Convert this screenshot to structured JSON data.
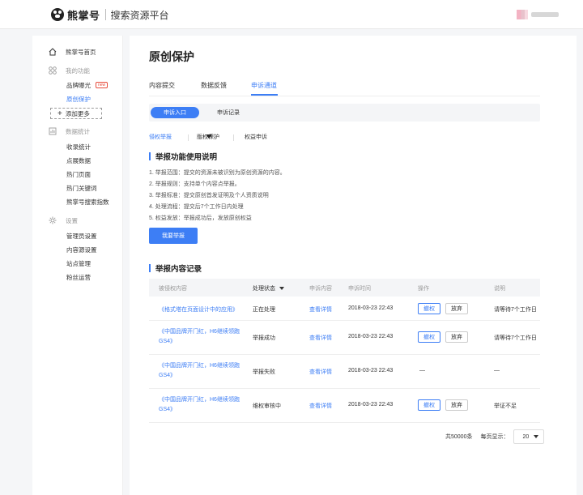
{
  "app": {
    "logo_text": "熊掌号",
    "subtitle": "搜索资源平台"
  },
  "sidebar": {
    "home": "熊掌号首页",
    "group_features": "我的功能",
    "features": [
      {
        "label": "品牌曝光",
        "badge": "new"
      },
      {
        "label": "原创保护"
      }
    ],
    "add_more": "添加更多",
    "group_stats": "数据统计",
    "stats": [
      "收录统计",
      "点展数据",
      "热门页面",
      "热门关键词",
      "熊掌号搜索指数"
    ],
    "group_settings": "设置",
    "settings": [
      "管理员设置",
      "内容源设置",
      "站点管理",
      "粉丝运营"
    ]
  },
  "page": {
    "title": "原创保护"
  },
  "tabs": [
    "内容提交",
    "数据反馈",
    "申诉通道"
  ],
  "segments": [
    "申诉入口",
    "申诉记录"
  ],
  "subtabs": [
    "侵权举报",
    "版权保护",
    "权益申诉"
  ],
  "instructions": {
    "title": "举报功能使用说明",
    "items": [
      "1. 举报范围：提交的资源未被识别为原创资源的内容。",
      "2. 举报规则：支持单个内容点举报。",
      "3. 举报标准：提交原创首发证明及个人资质说明",
      "4. 处理流程：提交后7个工作日内处理",
      "5. 权益发放：举报成功后，发放原创权益"
    ],
    "button": "我要举报"
  },
  "records": {
    "title": "举报内容记录",
    "columns": [
      "被侵权内容",
      "处理状态",
      "申诉内容",
      "申诉时间",
      "操作",
      "说明"
    ],
    "rows": [
      {
        "title": "《格式塔在页面设计中的应用》",
        "status": "正在处理",
        "content": "查看详情",
        "time": "2018-03-23  22:43",
        "actions": [
          "撤权",
          "放弃"
        ],
        "note": "请等待7个工作日"
      },
      {
        "title": "《中国品牌开门红，H6继续领跑GS4》",
        "status": "举报成功",
        "content": "查看详情",
        "time": "2018-03-23  22:43",
        "actions": [
          "撤权",
          "放弃"
        ],
        "note": "请等待7个工作日"
      },
      {
        "title": "《中国品牌开门红，H6继续领跑GS4》",
        "status": "举报失败",
        "content": "查看详情",
        "time": "2018-03-23  22:43",
        "action_text": "—",
        "note": "—"
      },
      {
        "title": "《中国品牌开门红，H6继续领跑GS4》",
        "status": "维权审核中",
        "content": "查看详情",
        "time": "2018-03-23  22:43",
        "actions": [
          "撤权",
          "放弃"
        ],
        "note": "举证不足"
      }
    ]
  },
  "pagination": {
    "total": "共50000条",
    "per_page_label": "每页显示：",
    "per_page": "20"
  },
  "colors": {
    "accent": "#3d7ef5",
    "new_badge": "#e74c3c"
  }
}
